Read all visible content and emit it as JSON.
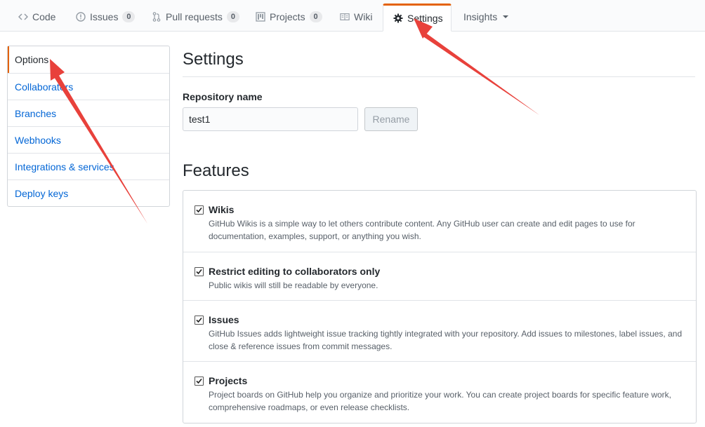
{
  "tabs": [
    {
      "key": "code",
      "label": "Code",
      "icon": "code-icon"
    },
    {
      "key": "issues",
      "label": "Issues",
      "icon": "issue-icon",
      "count": "0"
    },
    {
      "key": "pulls",
      "label": "Pull requests",
      "icon": "pull-request-icon",
      "count": "0"
    },
    {
      "key": "projects",
      "label": "Projects",
      "icon": "project-icon",
      "count": "0"
    },
    {
      "key": "wiki",
      "label": "Wiki",
      "icon": "book-icon"
    },
    {
      "key": "settings",
      "label": "Settings",
      "icon": "gear-icon",
      "selected": true
    },
    {
      "key": "insights",
      "label": "Insights",
      "icon": "chevron-down-icon"
    }
  ],
  "menu": [
    {
      "label": "Options",
      "selected": true
    },
    {
      "label": "Collaborators"
    },
    {
      "label": "Branches"
    },
    {
      "label": "Webhooks"
    },
    {
      "label": "Integrations & services"
    },
    {
      "label": "Deploy keys"
    }
  ],
  "main": {
    "heading": "Settings",
    "repo_label": "Repository name",
    "repo_value": "test1",
    "rename_label": "Rename",
    "features_heading": "Features"
  },
  "features": [
    {
      "title": "Wikis",
      "checked": true,
      "desc": "GitHub Wikis is a simple way to let others contribute content. Any GitHub user can create and edit pages to use for documentation, examples, support, or anything you wish."
    },
    {
      "title": "Restrict editing to collaborators only",
      "checked": true,
      "desc": "Public wikis will still be readable by everyone."
    },
    {
      "title": "Issues",
      "checked": true,
      "desc": "GitHub Issues adds lightweight issue tracking tightly integrated with your repository. Add issues to milestones, label issues, and close & reference issues from commit messages."
    },
    {
      "title": "Projects",
      "checked": true,
      "desc": "Project boards on GitHub help you organize and prioritize your work. You can create project boards for specific feature work, comprehensive roadmaps, or even release checklists."
    }
  ],
  "colors": {
    "accent": "#e36209",
    "link": "#0366d6",
    "annotation": "#e8413b"
  }
}
